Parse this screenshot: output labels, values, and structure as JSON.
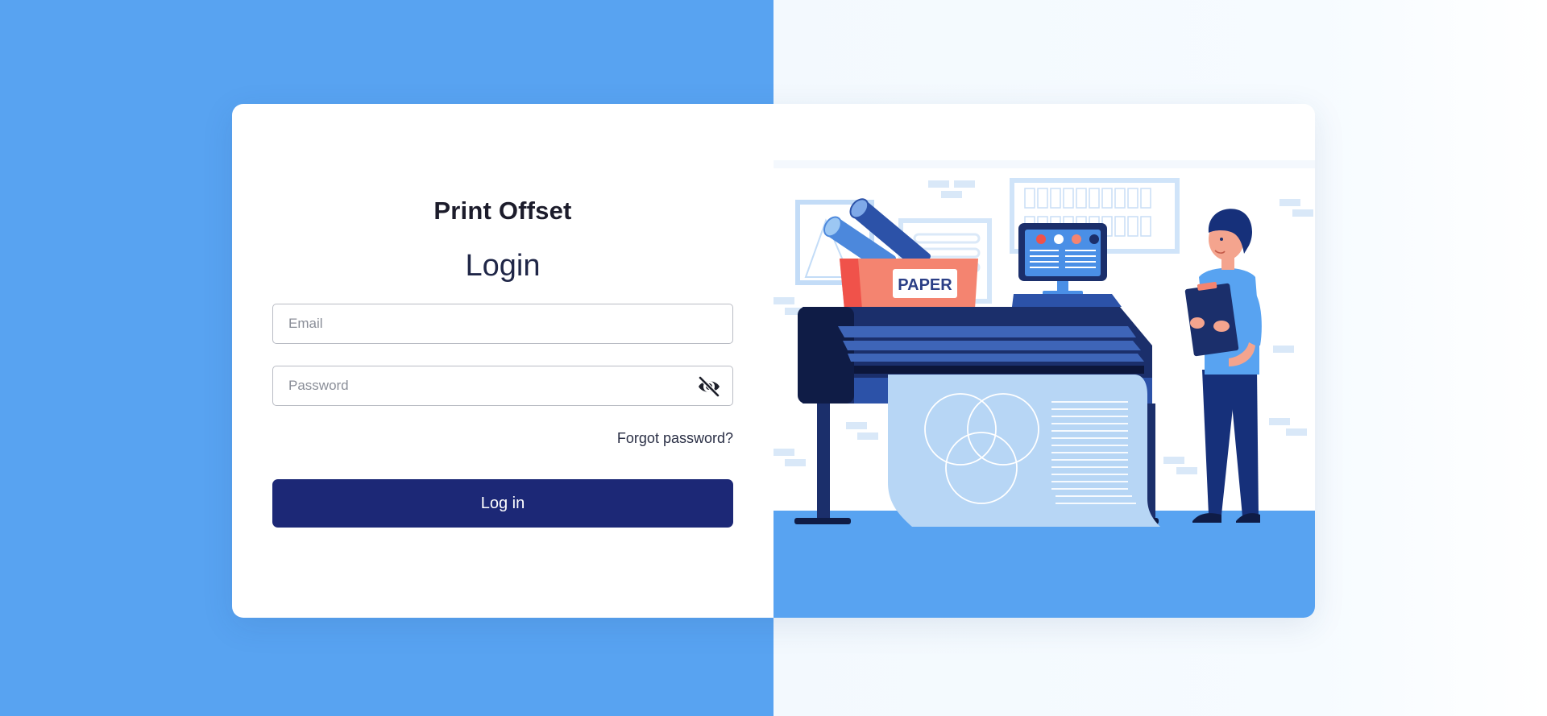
{
  "app": {
    "brand": "Print Offset",
    "title": "Login"
  },
  "form": {
    "email_placeholder": "Email",
    "email_value": "",
    "password_placeholder": "Password",
    "password_value": "",
    "password_toggle_icon": "eye-slash-icon",
    "forgot_label": "Forgot password?",
    "submit_label": "Log in"
  },
  "illustration": {
    "sign_text": "PAPER",
    "subject": "person-at-wide-format-printer"
  },
  "colors": {
    "left_background": "#58a3f1",
    "right_background": "#f4f9fe",
    "primary_button": "#1c2876",
    "printer_body": "#1b2f6b",
    "accent_red": "#f06a55"
  }
}
